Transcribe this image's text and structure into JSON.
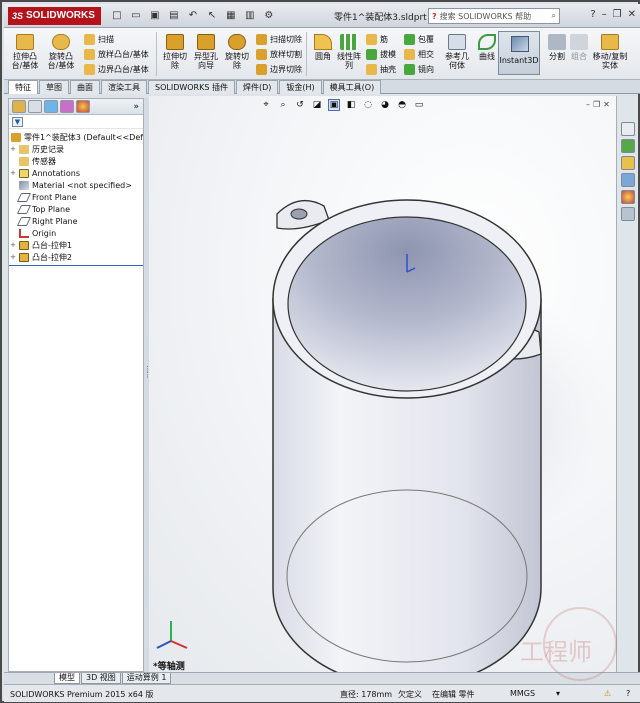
{
  "app": {
    "brand": "SOLIDWORKS",
    "brand_prefix": "3S",
    "document_title": "零件1^装配体3.sldprt"
  },
  "help_search": {
    "placeholder": "搜索 SOLIDWORKS 帮助"
  },
  "ribbon": {
    "extrude_boss": "拉伸凸台/基体",
    "revolve_boss": "旋转凸台/基体",
    "sweep": "扫描",
    "loft": "放样凸台/基体",
    "boundary": "边界凸台/基体",
    "extrude_cut": "拉伸切除",
    "hole_wizard": "异型孔向导",
    "revolve_cut": "旋转切除",
    "swept_cut": "扫描切除",
    "lofted_cut": "放样切割",
    "boundary_cut": "边界切除",
    "fillet": "圆角",
    "linear_pattern": "线性阵列",
    "rib": "筋",
    "draft": "拔模",
    "shell": "抽壳",
    "wrap": "包覆",
    "intersect": "相交",
    "mirror": "镜向",
    "ref_geometry": "参考几何体",
    "curves": "曲线",
    "instant3d": "Instant3D",
    "split": "分割",
    "combine": "组合",
    "move_copy": "移动/复制实体"
  },
  "tabs": [
    "特征",
    "草图",
    "曲面",
    "渲染工具",
    "SOLIDWORKS 插件",
    "焊件(D)",
    "钣金(H)",
    "模具工具(O)"
  ],
  "feature_tree": {
    "root": "零件1^装配体3  (Default<<Def",
    "items": [
      {
        "label": "历史记录",
        "icon": "history-icon"
      },
      {
        "label": "传感器",
        "icon": "sensor-icon"
      },
      {
        "label": "Annotations",
        "icon": "annotations-icon"
      },
      {
        "label": "Material <not specified>",
        "icon": "material-icon"
      },
      {
        "label": "Front Plane",
        "icon": "plane-icon"
      },
      {
        "label": "Top Plane",
        "icon": "plane-icon"
      },
      {
        "label": "Right Plane",
        "icon": "plane-icon"
      },
      {
        "label": "Origin",
        "icon": "origin-icon"
      },
      {
        "label": "凸台-拉伸1",
        "icon": "extrude-icon"
      },
      {
        "label": "凸台-拉伸2",
        "icon": "extrude-icon"
      }
    ]
  },
  "viewport": {
    "view_name": "*等轴测"
  },
  "bottom_tabs": [
    "模型",
    "3D 视图",
    "运动算例 1"
  ],
  "status": {
    "product": "SOLIDWORKS Premium 2015 x64 版",
    "diameter": "直径: 178mm",
    "defined": "欠定义",
    "editing": "在编辑 零件",
    "units": "MMGS"
  },
  "colors": {
    "brand": "#b5121b",
    "accent": "#2d66c4",
    "part": "#c9cdd8"
  }
}
